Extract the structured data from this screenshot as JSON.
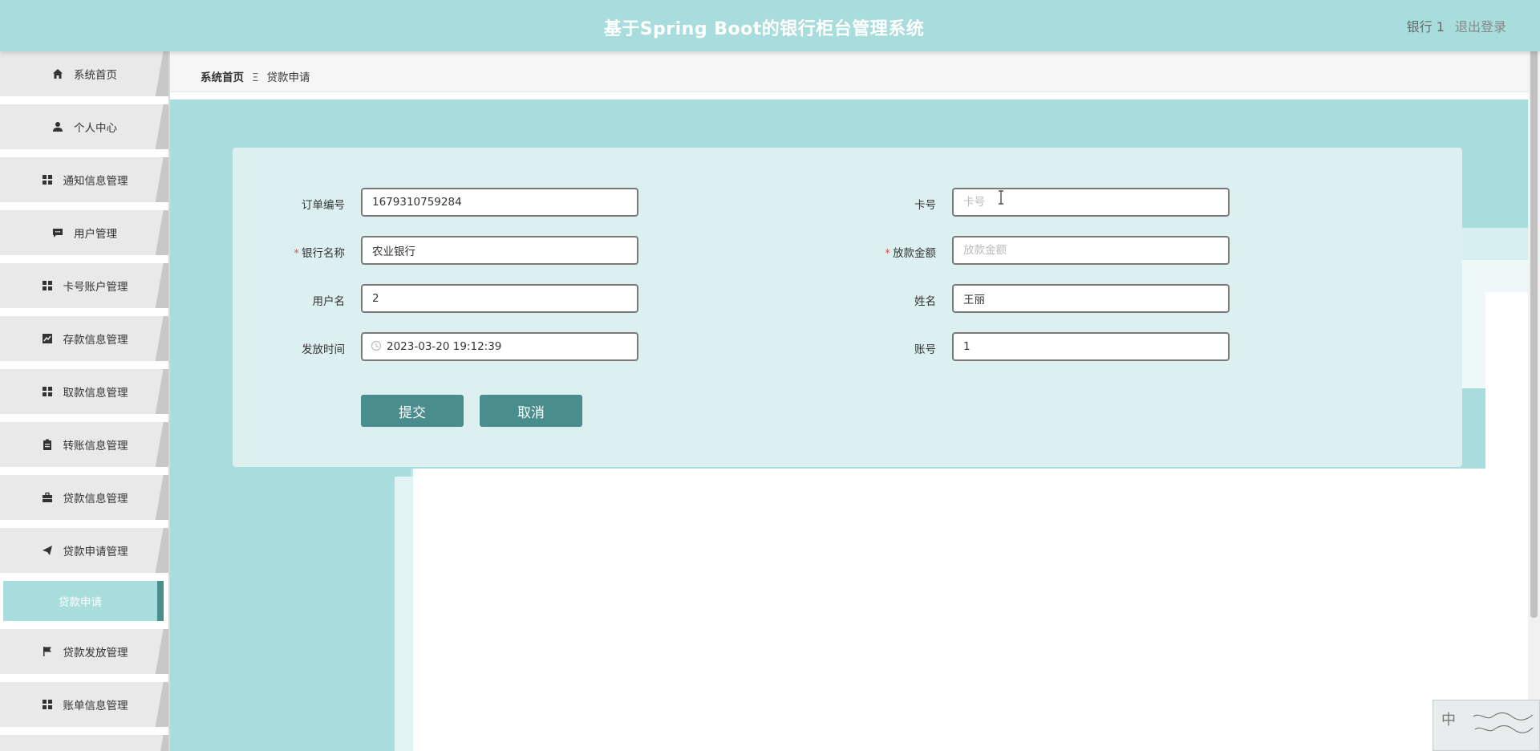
{
  "header": {
    "title": "基于Spring Boot的银行柜台管理系统",
    "user": "银行 1",
    "logout": "退出登录"
  },
  "sidebar": {
    "items": [
      {
        "label": "系统首页",
        "icon": "home-icon"
      },
      {
        "label": "个人中心",
        "icon": "user-icon"
      },
      {
        "label": "通知信息管理",
        "icon": "grid-icon"
      },
      {
        "label": "用户管理",
        "icon": "chat-icon"
      },
      {
        "label": "卡号账户管理",
        "icon": "grid-icon"
      },
      {
        "label": "存款信息管理",
        "icon": "chart-icon"
      },
      {
        "label": "取款信息管理",
        "icon": "grid-icon"
      },
      {
        "label": "转账信息管理",
        "icon": "clipboard-icon"
      },
      {
        "label": "贷款信息管理",
        "icon": "briefcase-icon"
      },
      {
        "label": "贷款申请管理",
        "icon": "send-icon"
      },
      {
        "label": "贷款发放管理",
        "icon": "flag-icon"
      },
      {
        "label": "账单信息管理",
        "icon": "grid-icon"
      }
    ],
    "active_sub": "贷款申请"
  },
  "breadcrumb": {
    "home": "系统首页",
    "separator": "Ξ",
    "current": "贷款申请"
  },
  "form": {
    "order_no": {
      "label": "订单编号",
      "value": "1679310759284"
    },
    "card_no": {
      "label": "卡号",
      "placeholder": "卡号"
    },
    "bank_name": {
      "label": "银行名称",
      "value": "农业银行",
      "required": true
    },
    "loan_amount": {
      "label": "放款金额",
      "placeholder": "放款金额",
      "required": true
    },
    "username": {
      "label": "用户名",
      "value": "2"
    },
    "name": {
      "label": "姓名",
      "value": "王丽"
    },
    "issue_time": {
      "label": "发放时间",
      "value": "2023-03-20 19:12:39"
    },
    "account_no": {
      "label": "账号",
      "value": "1"
    },
    "submit": "提交",
    "cancel": "取消",
    "required_mark": "*"
  },
  "ime": {
    "mode": "中"
  },
  "colors": {
    "header": "#a9dcdc",
    "button": "#4a8d8d",
    "card": "#ddf0f0"
  }
}
